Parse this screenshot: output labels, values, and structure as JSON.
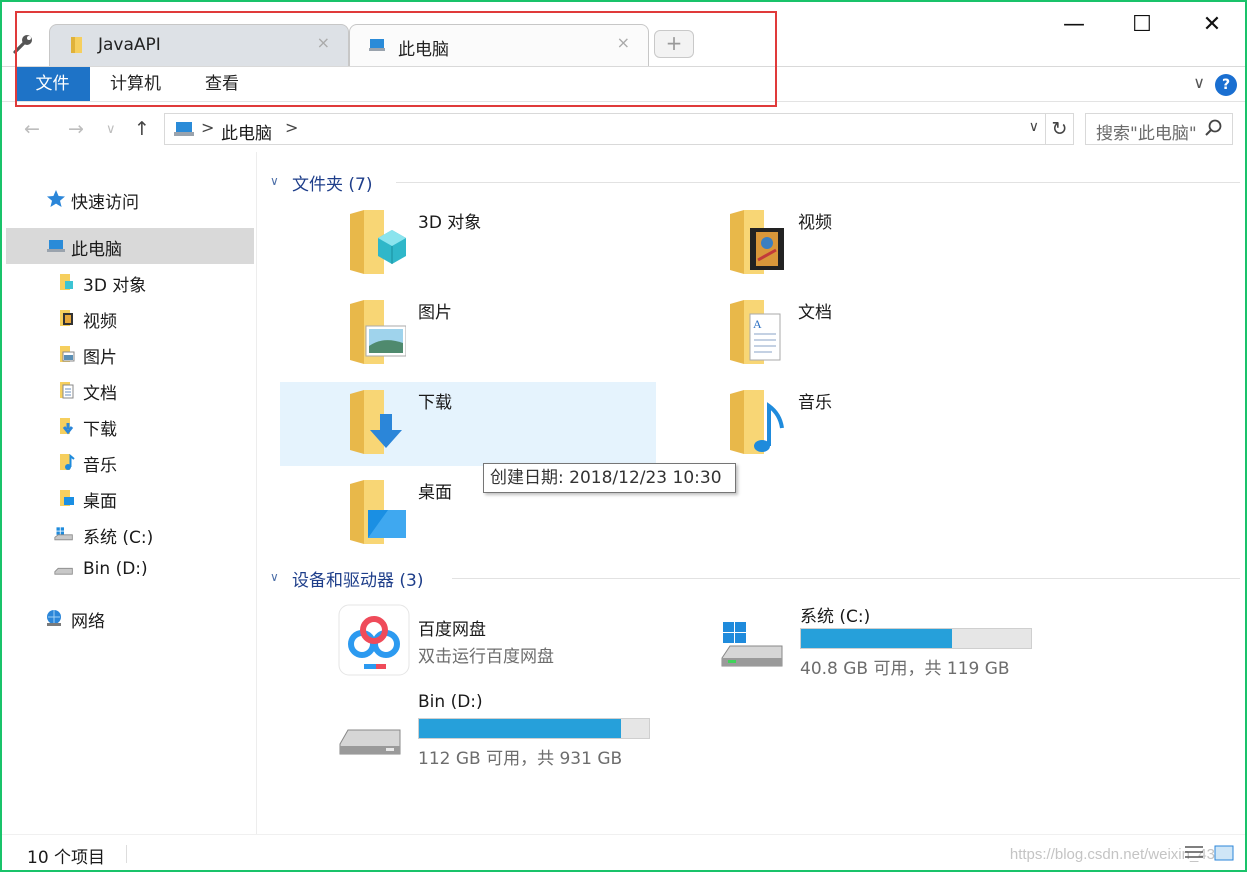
{
  "tabs": [
    {
      "label": "JavaAPI",
      "close": "×"
    },
    {
      "label": "此电脑",
      "close": "×"
    }
  ],
  "new_tab": "+",
  "window_controls": {
    "minimize": "—",
    "maximize": "☐",
    "close": "✕"
  },
  "ribbon": {
    "tabs": [
      "文件",
      "计算机",
      "查看"
    ],
    "help": "?",
    "expand": "∨"
  },
  "nav": {
    "back": "←",
    "forward": "→",
    "recent": "∨",
    "up": "↑"
  },
  "address": {
    "sep": ">",
    "crumb": "此电脑",
    "dropdown": "∨",
    "refresh": "↻"
  },
  "search": {
    "placeholder": "搜索\"此电脑\""
  },
  "sidebar": [
    {
      "label": "快速访问",
      "icon": "quick-access-star-icon"
    },
    {
      "label": "此电脑",
      "icon": "this-pc-icon",
      "selected": true
    },
    {
      "label": "3D 对象",
      "icon": "folder-3d-icon"
    },
    {
      "label": "视频",
      "icon": "folder-video-icon"
    },
    {
      "label": "图片",
      "icon": "folder-pictures-icon"
    },
    {
      "label": "文档",
      "icon": "folder-documents-icon"
    },
    {
      "label": "下载",
      "icon": "folder-downloads-icon"
    },
    {
      "label": "音乐",
      "icon": "folder-music-icon"
    },
    {
      "label": "桌面",
      "icon": "folder-desktop-icon"
    },
    {
      "label": "系统 (C:)",
      "icon": "drive-c-icon"
    },
    {
      "label": "Bin (D:)",
      "icon": "drive-d-icon"
    },
    {
      "label": "网络",
      "icon": "network-icon"
    }
  ],
  "folders_group": {
    "title": "文件夹 (7)"
  },
  "folders": [
    {
      "label": "3D 对象",
      "icon": "folder-3d-icon"
    },
    {
      "label": "视频",
      "icon": "folder-video-icon"
    },
    {
      "label": "图片",
      "icon": "folder-pictures-icon"
    },
    {
      "label": "文档",
      "icon": "folder-documents-icon"
    },
    {
      "label": "下载",
      "icon": "folder-downloads-icon"
    },
    {
      "label": "音乐",
      "icon": "folder-music-icon"
    },
    {
      "label": "桌面",
      "icon": "folder-desktop-icon"
    }
  ],
  "tooltip": "创建日期: 2018/12/23 10:30",
  "devices_group": {
    "title": "设备和驱动器 (3)"
  },
  "baidu": {
    "name": "百度网盘",
    "sub": "双击运行百度网盘"
  },
  "drives": [
    {
      "name": "系统 (C:)",
      "space": "40.8 GB 可用，共 119 GB",
      "used_fraction": 0.657
    },
    {
      "name": "Bin (D:)",
      "space": "112 GB 可用，共 931 GB",
      "used_fraction": 0.88
    }
  ],
  "status": {
    "count": "10 个项目",
    "watermark": "https://blog.csdn.net/weixin_43"
  },
  "colors": {
    "accent": "#1e73c7",
    "selection": "#e5f3fd",
    "drive_bar": "#26a0da",
    "window_border": "#19c36a",
    "annotation": "#e03a3a"
  }
}
